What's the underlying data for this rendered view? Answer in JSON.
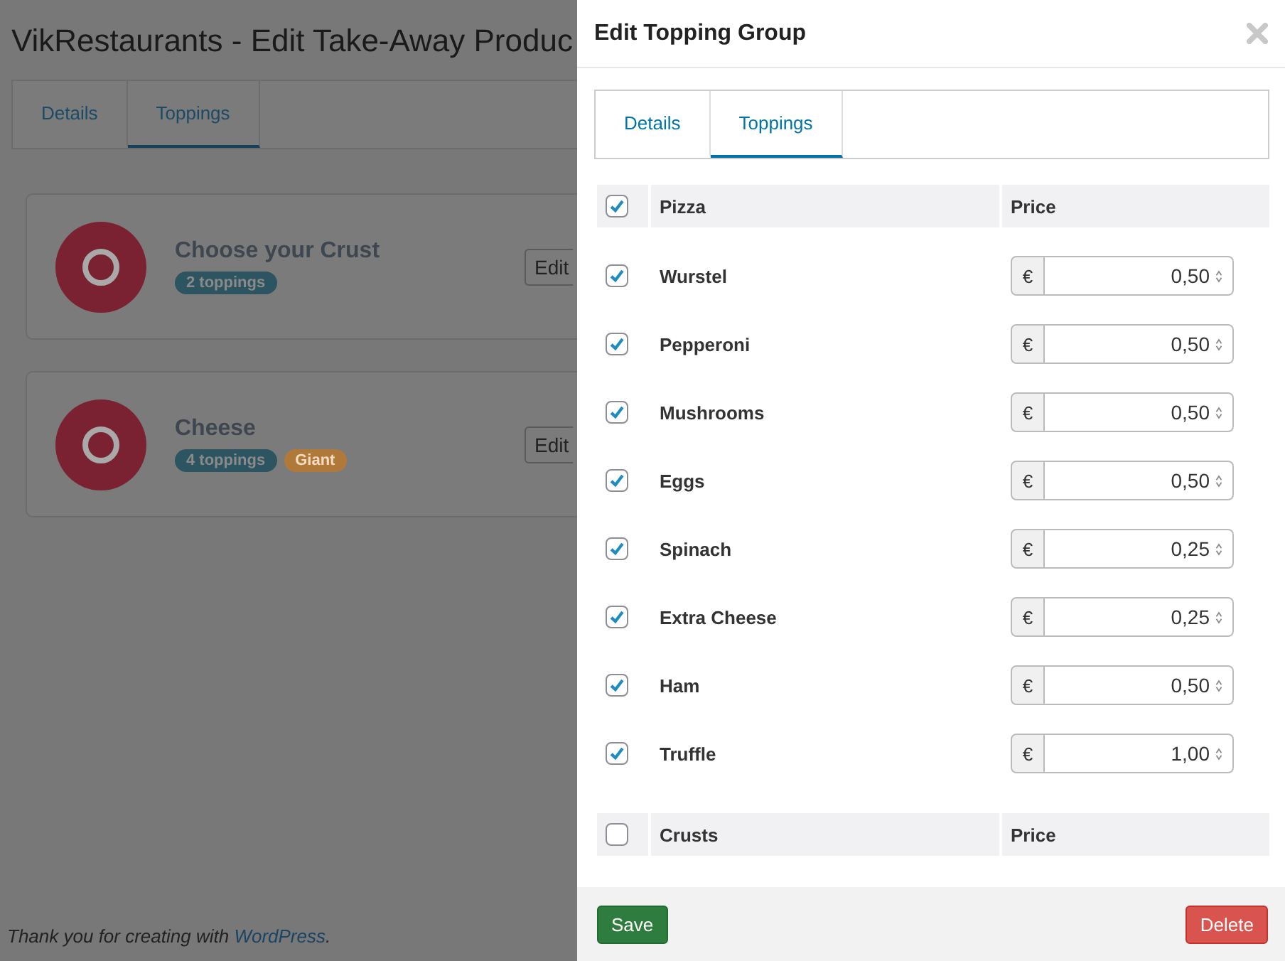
{
  "page": {
    "title": "VikRestaurants - Edit Take-Away Produc",
    "tabs": [
      {
        "label": "Details",
        "selected": false
      },
      {
        "label": "Toppings",
        "selected": true
      }
    ],
    "groups": [
      {
        "title": "Choose your Crust",
        "badges": [
          {
            "text": "2 toppings",
            "kind": "count"
          }
        ],
        "edit_button": "Edit"
      },
      {
        "title": "Cheese",
        "badges": [
          {
            "text": "4 toppings",
            "kind": "count"
          },
          {
            "text": "Giant",
            "kind": "variation"
          }
        ],
        "edit_button": "Edit"
      }
    ],
    "footer": {
      "text": "Thank you for creating with ",
      "link": "WordPress",
      "suffix": "."
    }
  },
  "modal": {
    "title": "Edit Topping Group",
    "tabs": [
      {
        "label": "Details",
        "selected": false
      },
      {
        "label": "Toppings",
        "selected": true
      }
    ],
    "sections": [
      {
        "name": "Pizza",
        "checked": true,
        "price_heading": "Price",
        "items": [
          {
            "name": "Wurstel",
            "checked": true,
            "currency": "€",
            "price": "0,50"
          },
          {
            "name": "Pepperoni",
            "checked": true,
            "currency": "€",
            "price": "0,50"
          },
          {
            "name": "Mushrooms",
            "checked": true,
            "currency": "€",
            "price": "0,50"
          },
          {
            "name": "Eggs",
            "checked": true,
            "currency": "€",
            "price": "0,50"
          },
          {
            "name": "Spinach",
            "checked": true,
            "currency": "€",
            "price": "0,25"
          },
          {
            "name": "Extra Cheese",
            "checked": true,
            "currency": "€",
            "price": "0,25"
          },
          {
            "name": "Ham",
            "checked": true,
            "currency": "€",
            "price": "0,50"
          },
          {
            "name": "Truffle",
            "checked": true,
            "currency": "€",
            "price": "1,00"
          }
        ]
      },
      {
        "name": "Crusts",
        "checked": false,
        "price_heading": "Price"
      }
    ],
    "buttons": [
      {
        "label": "Save",
        "kind": "primary"
      },
      {
        "label": "Delete",
        "kind": "danger"
      }
    ]
  }
}
